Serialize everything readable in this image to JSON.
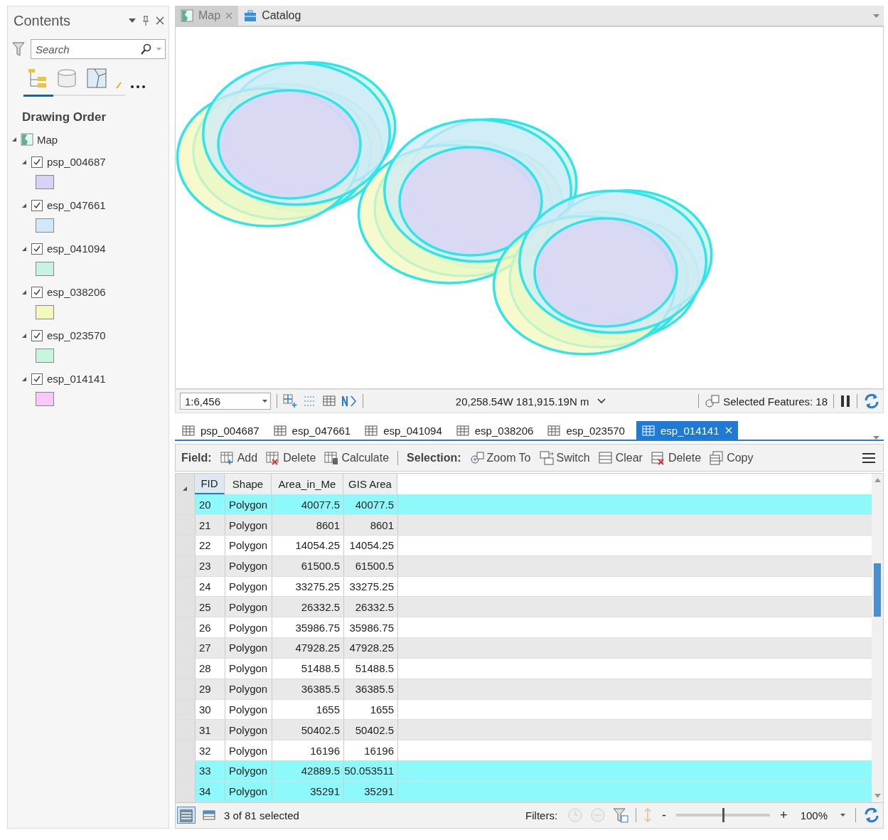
{
  "contents": {
    "title": "Contents",
    "search": {
      "placeholder": "Search"
    },
    "heading": "Drawing Order",
    "map": {
      "label": "Map",
      "expanded": true
    },
    "layers": [
      {
        "name": "psp_004687",
        "checked": true,
        "expanded": true,
        "color": "#d9d2f7"
      },
      {
        "name": "esp_047661",
        "checked": true,
        "expanded": true,
        "color": "#cfe9f8"
      },
      {
        "name": "esp_041094",
        "checked": true,
        "expanded": true,
        "color": "#c8f2e2"
      },
      {
        "name": "esp_038206",
        "checked": true,
        "expanded": true,
        "color": "#f4f8bc"
      },
      {
        "name": "esp_023570",
        "checked": true,
        "expanded": true,
        "color": "#c6f7de"
      },
      {
        "name": "esp_014141",
        "checked": true,
        "expanded": true,
        "color": "#f7c8f8"
      }
    ]
  },
  "view_tabs": [
    {
      "label": "Map",
      "selected": true,
      "closable": true
    },
    {
      "label": "Catalog",
      "selected": false,
      "closable": false
    }
  ],
  "map_status": {
    "scale": "1:6,456",
    "coordinates": "20,258.54W 181,915.19N m",
    "selected_features": "Selected Features: 18"
  },
  "table_tabs": [
    {
      "label": "psp_004687",
      "selected": false
    },
    {
      "label": "esp_047661",
      "selected": false
    },
    {
      "label": "esp_041094",
      "selected": false
    },
    {
      "label": "esp_038206",
      "selected": false
    },
    {
      "label": "esp_023570",
      "selected": false
    },
    {
      "label": "esp_014141",
      "selected": true
    }
  ],
  "toolbar": {
    "field_label": "Field:",
    "field_buttons": [
      "Add",
      "Delete",
      "Calculate"
    ],
    "selection_label": "Selection:",
    "selection_buttons": [
      "Zoom To",
      "Switch",
      "Clear",
      "Delete",
      "Copy"
    ]
  },
  "table": {
    "columns": [
      "FID",
      "Shape",
      "Area_in_Me",
      "GIS Area"
    ],
    "rows": [
      {
        "cells": [
          "20",
          "Polygon",
          "40077.5",
          "40077.5"
        ],
        "selected": true
      },
      {
        "cells": [
          "21",
          "Polygon",
          "8601",
          "8601"
        ],
        "selected": false
      },
      {
        "cells": [
          "22",
          "Polygon",
          "14054.25",
          "14054.25"
        ],
        "selected": false
      },
      {
        "cells": [
          "23",
          "Polygon",
          "61500.5",
          "61500.5"
        ],
        "selected": false
      },
      {
        "cells": [
          "24",
          "Polygon",
          "33275.25",
          "33275.25"
        ],
        "selected": false
      },
      {
        "cells": [
          "25",
          "Polygon",
          "26332.5",
          "26332.5"
        ],
        "selected": false
      },
      {
        "cells": [
          "26",
          "Polygon",
          "35986.75",
          "35986.75"
        ],
        "selected": false
      },
      {
        "cells": [
          "27",
          "Polygon",
          "47928.25",
          "47928.25"
        ],
        "selected": false
      },
      {
        "cells": [
          "28",
          "Polygon",
          "51488.5",
          "51488.5"
        ],
        "selected": false
      },
      {
        "cells": [
          "29",
          "Polygon",
          "36385.5",
          "36385.5"
        ],
        "selected": false
      },
      {
        "cells": [
          "30",
          "Polygon",
          "1655",
          "1655"
        ],
        "selected": false
      },
      {
        "cells": [
          "31",
          "Polygon",
          "50402.5",
          "50402.5"
        ],
        "selected": false
      },
      {
        "cells": [
          "32",
          "Polygon",
          "16196",
          "16196"
        ],
        "selected": false
      },
      {
        "cells": [
          "33",
          "Polygon",
          "42889.5",
          "50.053511"
        ],
        "selected": true
      },
      {
        "cells": [
          "34",
          "Polygon",
          "35291",
          "35291"
        ],
        "selected": true
      }
    ]
  },
  "status_bar": {
    "selection": "3 of 81 selected",
    "filters_label": "Filters:",
    "zoom": {
      "minus": "-",
      "plus": "+",
      "level": 0.5,
      "reading": "100%"
    }
  }
}
